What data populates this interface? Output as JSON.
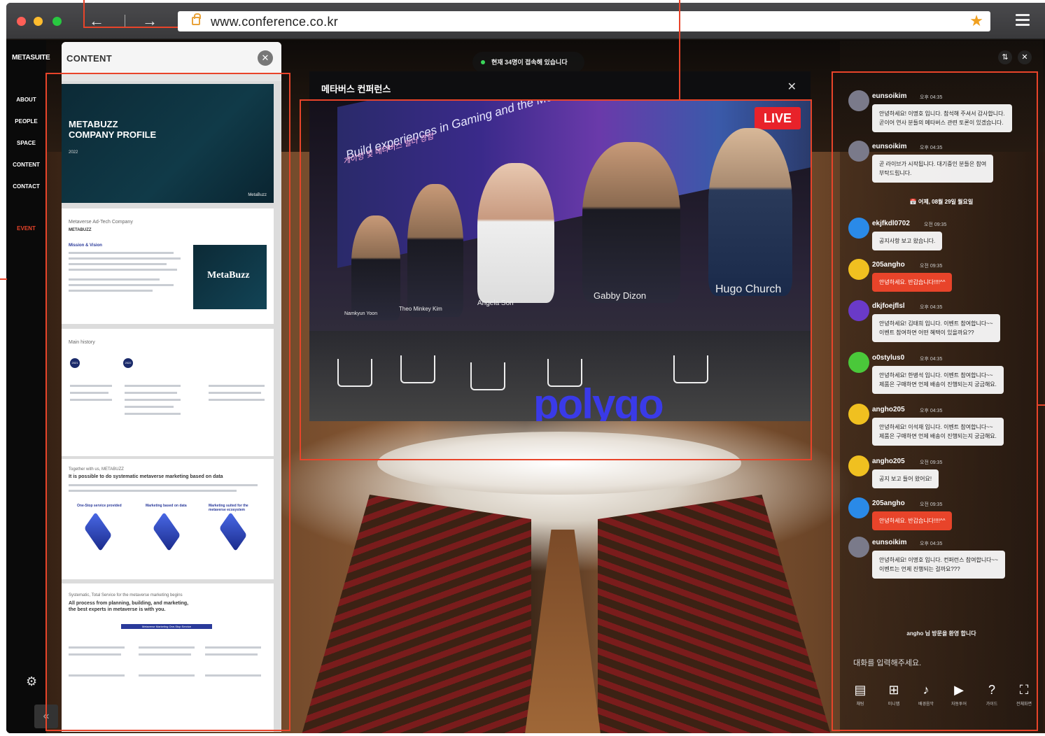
{
  "browser": {
    "url": "www.conference.co.kr",
    "back_icon": "arrow-left-icon",
    "forward_icon": "arrow-right-icon",
    "bookmark_icon": "star-icon",
    "menu_icon": "hamburger-menu-icon",
    "lock_icon": "lock-icon",
    "traffic_lights": [
      "#ff5f57",
      "#febc2e",
      "#28c840"
    ]
  },
  "sidebar": {
    "brand": "METASUITE",
    "items": [
      {
        "label": "ABOUT"
      },
      {
        "label": "PEOPLE"
      },
      {
        "label": "SPACE"
      },
      {
        "label": "CONTENT"
      },
      {
        "label": "CONTACT"
      },
      {
        "label": "EVENT",
        "active": true
      }
    ],
    "settings_icon": "gear-icon",
    "collapse_label": "«"
  },
  "status": {
    "viewer_count": "현재 34명이 접속해 있습니다"
  },
  "content_panel": {
    "title": "CONTENT",
    "close_label": "✕",
    "doc": {
      "cover_title": "METABUZZ\nCOMPANY PROFILE",
      "cover_year": "2022",
      "cover_logo": "MetaBuzz",
      "page2_heading": "Metaverse Ad-Tech Company",
      "page2_sub": "METABUZZ",
      "page2_section": "Mission & Vision",
      "page2_logo": "MetaBuzz",
      "page3_heading": "Main history",
      "page3_years": [
        "2021",
        "2022"
      ],
      "page4_heading": "Together with us, METABUZZ",
      "page4_title": "It is possible to do systematic metaverse marketing based on data",
      "page4_cols": [
        "One-Stop service provided",
        "Marketing based on data",
        "Marketing suited for the metaverse ecosystem"
      ],
      "page5_heading": "Systematic, Total Service for the metaverse marketing begins",
      "page5_title": "All process from planning, building, and marketing,\nthe best experts in metaverse is with you.",
      "page5_button": "Metaverse Marketing One-Stop Service"
    }
  },
  "video_panel": {
    "title": "메타버스 컨퍼런스",
    "close_label": "✕",
    "live_badge": "LIVE",
    "screen_text": "Build experiences in Gaming and the Metave...",
    "screen_text_kr": "게이밍 및 메타버스 빌더 경험",
    "speakers": [
      {
        "name": "Namkyun Yoon"
      },
      {
        "name": "Theo Minkey Kim"
      },
      {
        "name": "Angela Son"
      },
      {
        "name": "Gabby Dizon"
      },
      {
        "name": "Hugo Church"
      }
    ],
    "stage_logo": "polygo"
  },
  "chat": {
    "swap_icon": "swap-icon",
    "close_label": "✕",
    "messages": [
      {
        "user": "eunsoikim",
        "time": "오후 04:35",
        "text": "안녕하세요! 이명호 입니다. 참석해 주셔서 감사합니다.\n곧이어 연사 분들의 메타버스 관련 토론이 있겠습니다.",
        "avatar_bg": "#7a7a8a",
        "red": false
      },
      {
        "user": "eunsoikim",
        "time": "오후 04:35",
        "text": "곧 라이브가 시작됩니다. 대기중인 분들은 참여\n부탁드립니다.",
        "avatar_bg": "#7a7a8a",
        "red": false
      },
      {
        "user": "ekjfkdl0702",
        "time": "오전 09:35",
        "text": "공지사항 보고 왔습니다.",
        "avatar_bg": "#2a8ae8",
        "red": false
      },
      {
        "user": "205angho",
        "time": "오전 09:35",
        "text": "안녕하세요. 반갑습니다!!!!^^",
        "avatar_bg": "#f0c020",
        "red": true
      },
      {
        "user": "dkjfoejflsl",
        "time": "오후 04:35",
        "text": "안녕하세요! 김태희 입니다. 이벤트 참여합니다~~\n이벤트 참여하면 어떤 혜택이 있을까요??",
        "avatar_bg": "#6a3ac8",
        "red": false
      },
      {
        "user": "o0stylus0",
        "time": "오후 04:35",
        "text": "안녕하세요! 한병석 입니다. 이벤트 참여합니다~~\n제품은 구매하면 언제 배송이 진행되는지 궁금해요.",
        "avatar_bg": "#4ac83a",
        "red": false
      },
      {
        "user": "angho205",
        "time": "오후 04:35",
        "text": "안녕하세요! 이석재 입니다. 이벤트 참여합니다~~\n제품은 구매하면 언제 배송이 진행되는지 궁금해요.",
        "avatar_bg": "#f0c020",
        "red": false
      },
      {
        "user": "angho205",
        "time": "오전 09:35",
        "text": "공지 보고 들어 왔어요!",
        "avatar_bg": "#f0c020",
        "red": false
      },
      {
        "user": "205angho",
        "time": "오전 09:35",
        "text": "안녕하세요. 반갑습니다!!!!^^",
        "avatar_bg": "#2a8ae8",
        "red": true
      },
      {
        "user": "eunsoikim",
        "time": "오후 04:35",
        "text": "안녕하세요! 이명호 입니다. 컨퍼런스 참여합니다~~\n이벤트는 언제 진행되는 걸까요???",
        "avatar_bg": "#7a7a8a",
        "red": false
      }
    ],
    "date_separator": "어제, 08월 29일 월요일",
    "notice": "angho 님 방문을 환영 합니다",
    "input_placeholder": "대화를 입력해주세요.",
    "toolbar": [
      {
        "icon": "chat-icon",
        "label": "채팅"
      },
      {
        "icon": "map-icon",
        "label": "미니맵"
      },
      {
        "icon": "mute-icon",
        "label": "배경음악"
      },
      {
        "icon": "play-icon",
        "label": "자동투어"
      },
      {
        "icon": "help-icon",
        "label": "가이드"
      },
      {
        "icon": "fullscreen-icon",
        "label": "전체화면"
      }
    ]
  },
  "accent_color": "#e8442a"
}
